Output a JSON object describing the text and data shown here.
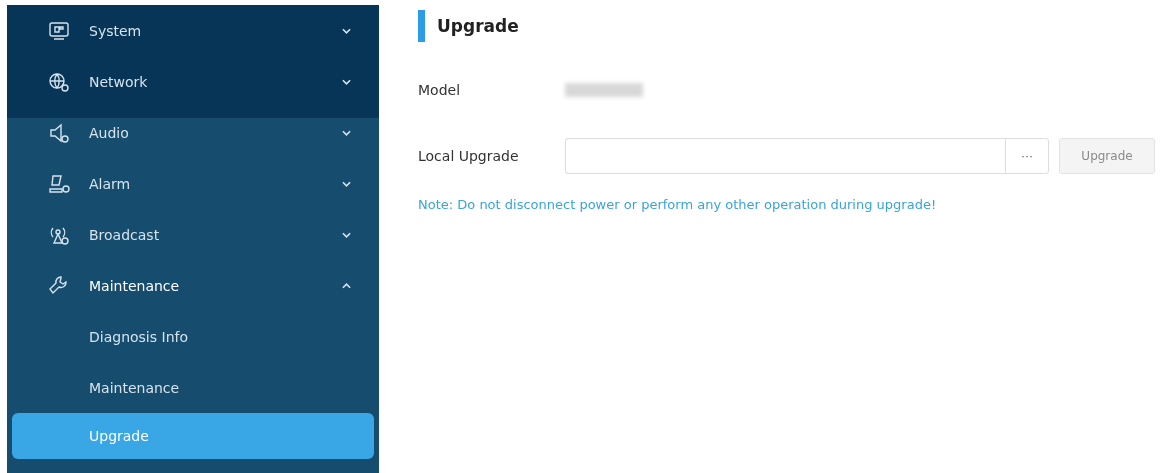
{
  "sidebar": {
    "items": [
      {
        "label": "System",
        "expanded": false
      },
      {
        "label": "Network",
        "expanded": false
      },
      {
        "label": "Audio",
        "expanded": false
      },
      {
        "label": "Alarm",
        "expanded": false
      },
      {
        "label": "Broadcast",
        "expanded": false
      },
      {
        "label": "Maintenance",
        "expanded": true,
        "children": [
          {
            "label": "Diagnosis Info",
            "selected": false
          },
          {
            "label": "Maintenance",
            "selected": false
          },
          {
            "label": "Upgrade",
            "selected": true
          }
        ]
      }
    ]
  },
  "page": {
    "title": "Upgrade",
    "model": {
      "label": "Model"
    },
    "local_upgrade": {
      "label": "Local Upgrade",
      "browse": "···",
      "button": {
        "label": "Upgrade",
        "disabled": true
      }
    },
    "note": "Note: Do not disconnect power or perform any other operation during upgrade!"
  }
}
